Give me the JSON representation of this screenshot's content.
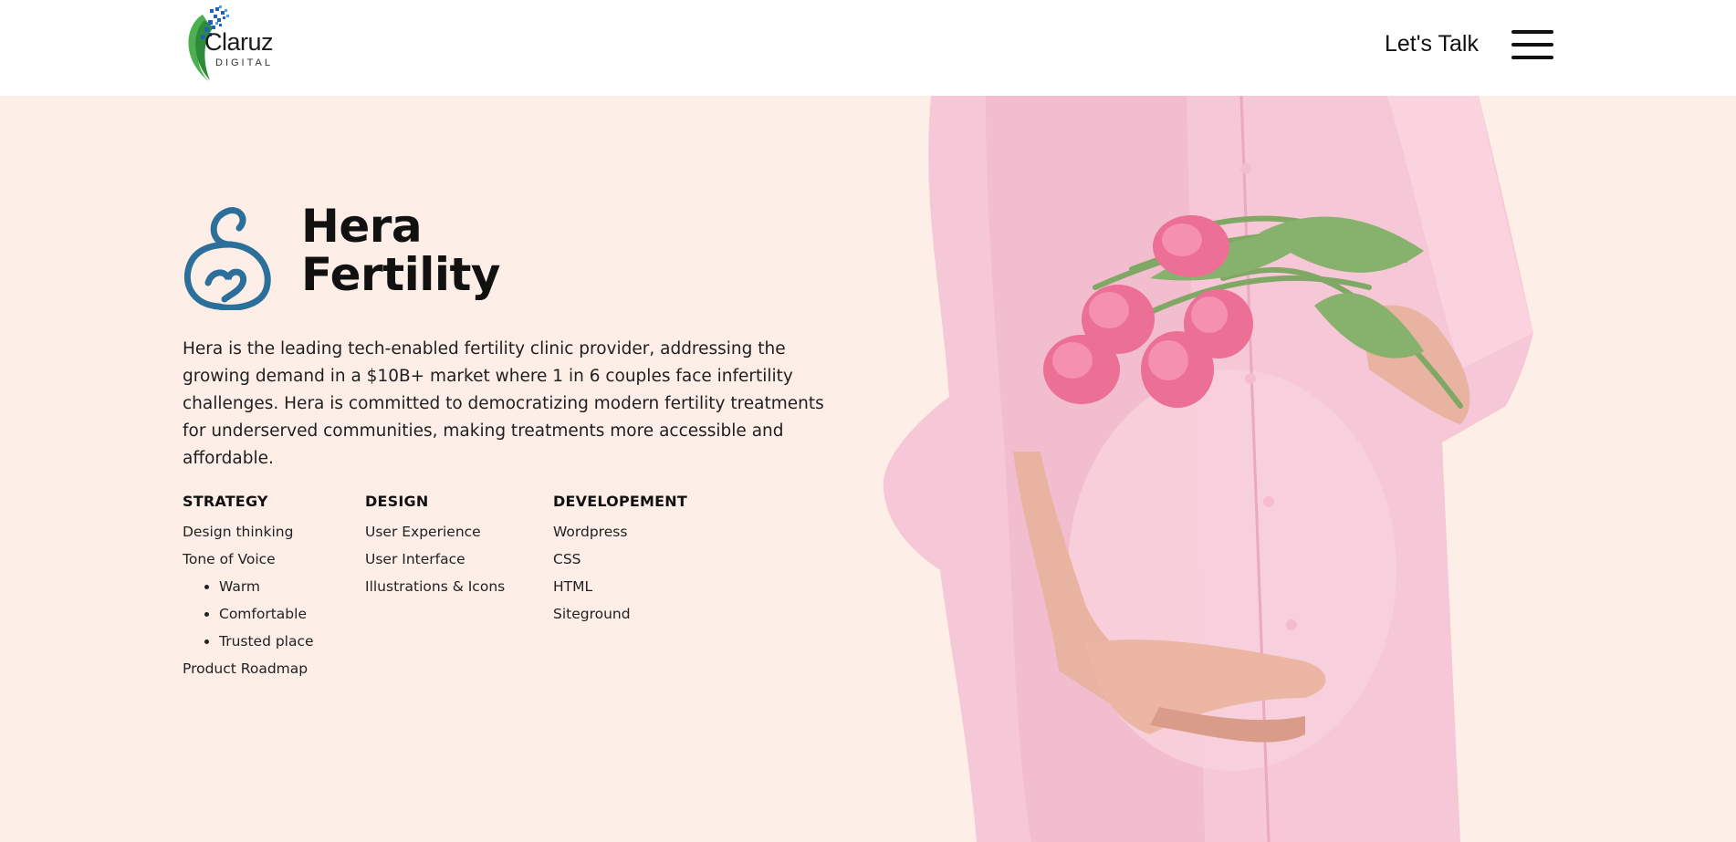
{
  "header": {
    "logo_name": "Claruz",
    "logo_sub": "DIGITAL",
    "cta_label": "Let's Talk",
    "menu_icon": "hamburger-menu-icon"
  },
  "project": {
    "title_line1": "Hera",
    "title_line2": "Fertility",
    "description": "Hera is the leading tech-enabled fertility clinic provider, addressing the growing demand in a $10B+ market where 1 in 6 couples face infertility challenges. Hera is committed to democratizing modern fertility treatments for underserved communities, making treatments more accessible and affordable.",
    "brand_icon": "hera-mother-heart-icon",
    "brand_color": "#2b6f9b"
  },
  "services": {
    "strategy": {
      "heading": "STRATEGY",
      "items": [
        "Design thinking",
        "Tone of Voice"
      ],
      "tone_bullets": [
        "Warm",
        "Comfortable",
        "Trusted place"
      ],
      "last": "Product Roadmap"
    },
    "design": {
      "heading": "DESIGN",
      "items": [
        "User Experience",
        "User Interface",
        "Illustrations & Icons"
      ]
    },
    "development": {
      "heading": "DEVELOPEMENT",
      "items": [
        "Wordpress",
        "CSS",
        "HTML",
        "Siteground"
      ]
    }
  },
  "colors": {
    "hero_background": "#fdeee7",
    "header_background": "#ffffff"
  },
  "hero_image": "pregnant-woman-pink-shirt-holding-tulips-image"
}
